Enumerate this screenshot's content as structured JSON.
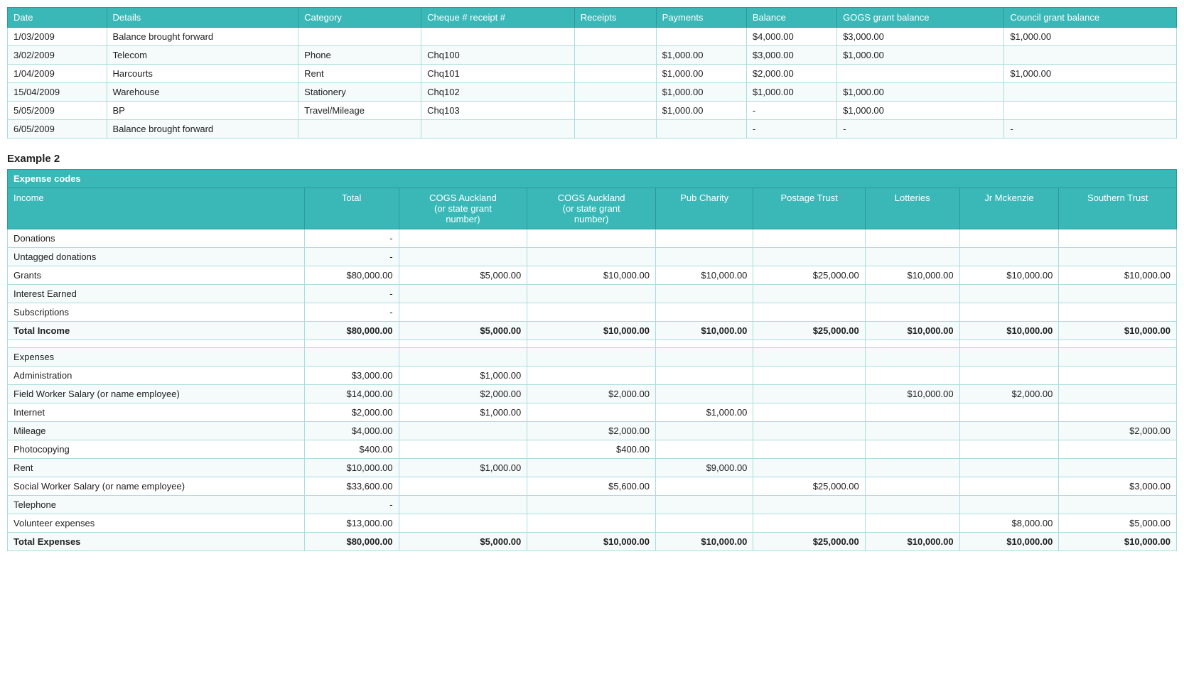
{
  "table1": {
    "columns": [
      "Date",
      "Details",
      "Category",
      "Cheque # receipt #",
      "Receipts",
      "Payments",
      "Balance",
      "GOGS grant balance",
      "Council grant balance"
    ],
    "rows": [
      [
        "1/03/2009",
        "Balance brought forward",
        "",
        "",
        "",
        "",
        "$4,000.00",
        "$3,000.00",
        "$1,000.00"
      ],
      [
        "3/02/2009",
        "Telecom",
        "Phone",
        "Chq100",
        "",
        "$1,000.00",
        "$3,000.00",
        "$1,000.00",
        ""
      ],
      [
        "1/04/2009",
        "Harcourts",
        "Rent",
        "Chq101",
        "",
        "$1,000.00",
        "$2,000.00",
        "",
        "$1,000.00"
      ],
      [
        "15/04/2009",
        "Warehouse",
        "Stationery",
        "Chq102",
        "",
        "$1,000.00",
        "$1,000.00",
        "$1,000.00",
        ""
      ],
      [
        "5/05/2009",
        "BP",
        "Travel/Mileage",
        "Chq103",
        "",
        "$1,000.00",
        "-",
        "$1,000.00",
        ""
      ],
      [
        "6/05/2009",
        "Balance brought forward",
        "",
        "",
        "",
        "",
        "-",
        "-",
        "-"
      ]
    ]
  },
  "example2_title": "Example 2",
  "table2": {
    "header_label": "Expense codes",
    "columns": [
      "Income",
      "Total",
      "COGS Auckland\n(or state grant\nnumber)",
      "COGS Auckland\n(or state grant\nnumber)",
      "Pub Charity",
      "Postage Trust",
      "Lotteries",
      "Jr Mckenzie",
      "Southern Trust"
    ],
    "rows": [
      {
        "label": "Donations",
        "values": [
          "",
          "-",
          "",
          "",
          "",
          "",
          "",
          "",
          ""
        ]
      },
      {
        "label": "Untagged donations",
        "values": [
          "",
          "-",
          "",
          "",
          "",
          "",
          "",
          "",
          ""
        ]
      },
      {
        "label": "Grants",
        "values": [
          "",
          "$80,000.00",
          "$5,000.00",
          "$10,000.00",
          "$10,000.00",
          "$25,000.00",
          "$10,000.00",
          "$10,000.00",
          "$10,000.00"
        ]
      },
      {
        "label": "Interest Earned",
        "values": [
          "",
          "-",
          "",
          "",
          "",
          "",
          "",
          "",
          ""
        ]
      },
      {
        "label": "Subscriptions",
        "values": [
          "",
          "-",
          "",
          "",
          "",
          "",
          "",
          "",
          ""
        ]
      },
      {
        "label": "Total Income",
        "values": [
          "",
          "$80,000.00",
          "$5,000.00",
          "$10,000.00",
          "$10,000.00",
          "$25,000.00",
          "$10,000.00",
          "$10,000.00",
          "$10,000.00"
        ],
        "bold": true
      },
      {
        "label": "",
        "values": [
          "",
          "",
          "",
          "",
          "",
          "",
          "",
          "",
          ""
        ]
      },
      {
        "label": "Expenses",
        "values": [
          "",
          "",
          "",
          "",
          "",
          "",
          "",
          "",
          ""
        ]
      },
      {
        "label": "Administration",
        "values": [
          "",
          "$3,000.00",
          "$1,000.00",
          "",
          "",
          "",
          "",
          "",
          ""
        ]
      },
      {
        "label": "Field Worker Salary (or name employee)",
        "values": [
          "",
          "$14,000.00",
          "$2,000.00",
          "$2,000.00",
          "",
          "",
          "$10,000.00",
          "$2,000.00",
          ""
        ]
      },
      {
        "label": "Internet",
        "values": [
          "",
          "$2,000.00",
          "$1,000.00",
          "",
          "$1,000.00",
          "",
          "",
          "",
          ""
        ]
      },
      {
        "label": "Mileage",
        "values": [
          "",
          "$4,000.00",
          "",
          "$2,000.00",
          "",
          "",
          "",
          "",
          "$2,000.00"
        ]
      },
      {
        "label": "Photocopying",
        "values": [
          "",
          "$400.00",
          "",
          "$400.00",
          "",
          "",
          "",
          "",
          ""
        ]
      },
      {
        "label": "Rent",
        "values": [
          "",
          "$10,000.00",
          "$1,000.00",
          "",
          "$9,000.00",
          "",
          "",
          "",
          ""
        ]
      },
      {
        "label": "Social Worker Salary (or name employee)",
        "values": [
          "",
          "$33,600.00",
          "",
          "$5,600.00",
          "",
          "$25,000.00",
          "",
          "",
          "$3,000.00"
        ]
      },
      {
        "label": "Telephone",
        "values": [
          "",
          "-",
          "",
          "",
          "",
          "",
          "",
          "",
          ""
        ]
      },
      {
        "label": "Volunteer expenses",
        "values": [
          "",
          "$13,000.00",
          "",
          "",
          "",
          "",
          "",
          "$8,000.00",
          "$5,000.00"
        ]
      },
      {
        "label": "Total Expenses",
        "values": [
          "",
          "$80,000.00",
          "$5,000.00",
          "$10,000.00",
          "$10,000.00",
          "$25,000.00",
          "$10,000.00",
          "$10,000.00",
          "$10,000.00"
        ],
        "bold": true
      }
    ]
  }
}
